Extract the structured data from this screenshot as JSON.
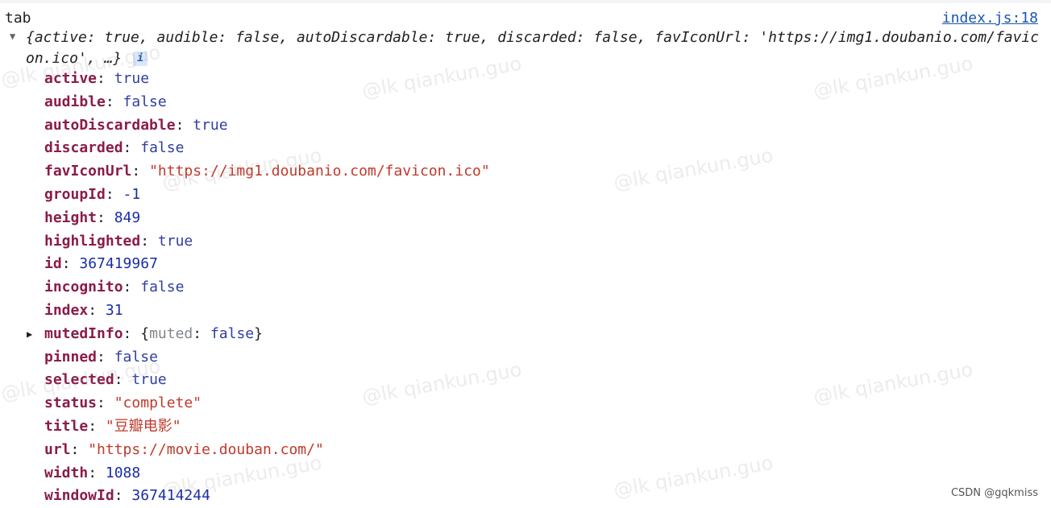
{
  "console": {
    "label": "tab",
    "source_link": "index.js:18",
    "summary_prefix": "{",
    "summary_rest": "active: true, audible: false, autoDiscardable: true, discarded: false, favIconUrl: 'https://img1.doubanio.com/favicon.ico', …}",
    "info_badge": "i",
    "toggle_icon": "caret-down-icon",
    "properties": [
      {
        "key": "active",
        "value": "true",
        "type": "bool"
      },
      {
        "key": "audible",
        "value": "false",
        "type": "bool"
      },
      {
        "key": "autoDiscardable",
        "value": "true",
        "type": "bool"
      },
      {
        "key": "discarded",
        "value": "false",
        "type": "bool"
      },
      {
        "key": "favIconUrl",
        "value": "\"https://img1.doubanio.com/favicon.ico\"",
        "type": "str"
      },
      {
        "key": "groupId",
        "value": "-1",
        "type": "num"
      },
      {
        "key": "height",
        "value": "849",
        "type": "num"
      },
      {
        "key": "highlighted",
        "value": "true",
        "type": "bool"
      },
      {
        "key": "id",
        "value": "367419967",
        "type": "num"
      },
      {
        "key": "incognito",
        "value": "false",
        "type": "bool"
      },
      {
        "key": "index",
        "value": "31",
        "type": "num"
      },
      {
        "key": "mutedInfo",
        "value_open": "{",
        "value_inner_key": "muted",
        "value_inner_value": "false",
        "value_close": "}",
        "type": "object",
        "expandable": true
      },
      {
        "key": "pinned",
        "value": "false",
        "type": "bool"
      },
      {
        "key": "selected",
        "value": "true",
        "type": "bool"
      },
      {
        "key": "status",
        "value": "\"complete\"",
        "type": "str"
      },
      {
        "key": "title",
        "value": "\"豆瓣电影\"",
        "type": "str"
      },
      {
        "key": "url",
        "value": "\"https://movie.douban.com/\"",
        "type": "str"
      },
      {
        "key": "width",
        "value": "1088",
        "type": "num"
      },
      {
        "key": "windowId",
        "value": "367414244",
        "type": "num"
      }
    ]
  },
  "watermark": {
    "text": "@lk qiankun.guo"
  },
  "corner_credit": "CSDN @gqkmiss"
}
